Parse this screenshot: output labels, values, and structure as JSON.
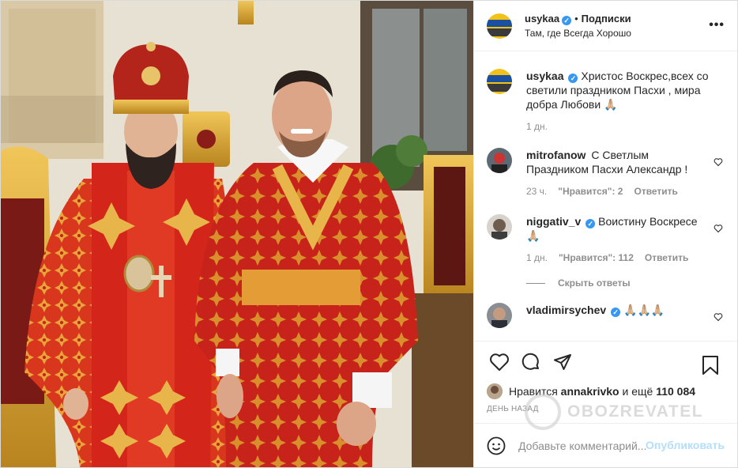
{
  "post": {
    "author": "usykaa",
    "follow_label": "Подписки",
    "location": "Там, где Всегда Хорошо",
    "caption": "Христос Воскрес,всех со светили праздником Пасхи , мира добра Любови 🙏🏼",
    "caption_time": "1 дн."
  },
  "comments": [
    {
      "user": "mitrofanow",
      "text": "С Светлым Праздником Пасхи Александр !",
      "time": "23 ч.",
      "likes": "\"Нравится\": 2",
      "reply": "Ответить",
      "verified": false
    },
    {
      "user": "niggativ_v",
      "text": "Воистину Воскресе 🙏🏼",
      "time": "1 дн.",
      "likes": "\"Нравится\": 112",
      "reply": "Ответить",
      "verified": true
    },
    {
      "user": "vladimirsychev",
      "text": "🙏🏼🙏🏼🙏🏼",
      "verified": true
    }
  ],
  "hide_replies": "Скрыть ответы",
  "likes": {
    "prefix": "Нравится",
    "user": "annakrivko",
    "suffix": "и ещё",
    "count": "110 084"
  },
  "date": "День назад",
  "watermark": "OBOZREVATEL",
  "comment_box": {
    "placeholder": "Добавьте комментарий...",
    "publish": "Опубликовать"
  },
  "icons": {
    "more": "more-horizontal-icon",
    "like": "heart-icon",
    "comment": "comment-icon",
    "share": "paper-plane-icon",
    "save": "bookmark-icon",
    "emoji": "smiley-icon",
    "verified": "verified-badge-icon"
  },
  "colors": {
    "verified": "#3897f0",
    "text": "#262626",
    "muted": "#8e8e8e",
    "publish_disabled": "#b2dffc"
  }
}
